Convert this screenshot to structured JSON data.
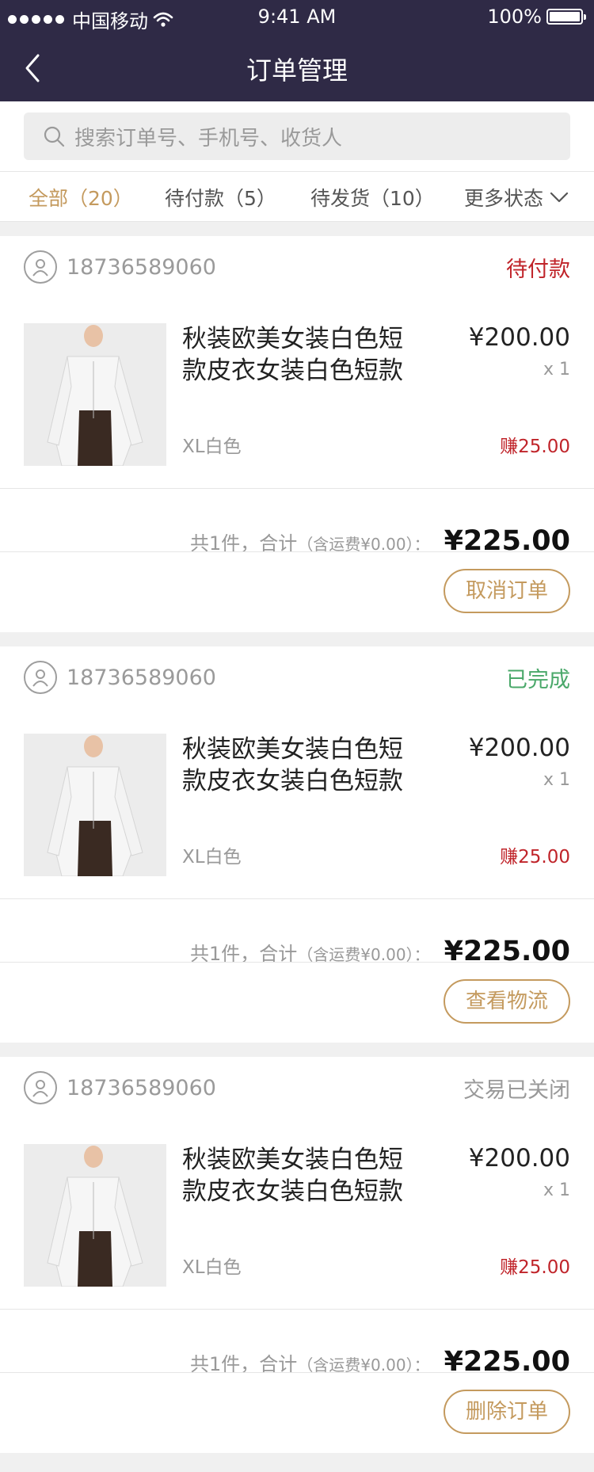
{
  "status_bar": {
    "carrier": "中国移动",
    "time": "9:41 AM",
    "battery": "100%"
  },
  "nav": {
    "title": "订单管理"
  },
  "search": {
    "placeholder": "搜索订单号、手机号、收货人"
  },
  "tabs": [
    {
      "label": "全部（20）"
    },
    {
      "label": "待付款（5）"
    },
    {
      "label": "待发货（10）"
    },
    {
      "label": "更多状态"
    }
  ],
  "colors": {
    "header": "#2f2a46",
    "accent": "#c49a5e",
    "status_pending": "#c0242a",
    "status_done": "#4aa86a",
    "status_closed": "#999999"
  },
  "orders": [
    {
      "phone": "18736589060",
      "status": "待付款",
      "status_color": "#c0242a",
      "product_name": "秋装欧美女装白色短款皮衣女装白色短款",
      "price": "¥200.00",
      "qty": "x 1",
      "spec": "XL白色",
      "earn": "赚25.00",
      "summary_count": "共1件，合计",
      "summary_ship": "（含运费¥0.00）：",
      "total": "¥225.00",
      "action": "取消订单"
    },
    {
      "phone": "18736589060",
      "status": "已完成",
      "status_color": "#4aa86a",
      "product_name": "秋装欧美女装白色短款皮衣女装白色短款",
      "price": "¥200.00",
      "qty": "x 1",
      "spec": "XL白色",
      "earn": "赚25.00",
      "summary_count": "共1件，合计",
      "summary_ship": "（含运费¥0.00）：",
      "total": "¥225.00",
      "action": "查看物流"
    },
    {
      "phone": "18736589060",
      "status": "交易已关闭",
      "status_color": "#999999",
      "product_name": "秋装欧美女装白色短款皮衣女装白色短款",
      "price": "¥200.00",
      "qty": "x 1",
      "spec": "XL白色",
      "earn": "赚25.00",
      "summary_count": "共1件，合计",
      "summary_ship": "（含运费¥0.00）：",
      "total": "¥225.00",
      "action": "删除订单"
    }
  ]
}
